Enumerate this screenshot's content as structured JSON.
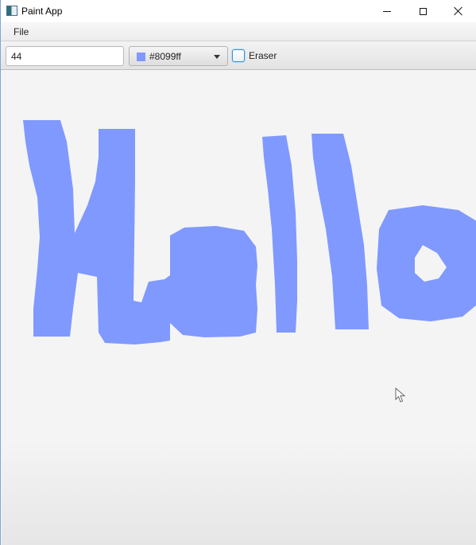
{
  "window": {
    "title": "Paint App",
    "icon": "app-icon",
    "controls": [
      "minimize-icon",
      "maximize-icon",
      "close-icon"
    ]
  },
  "menubar": {
    "items": [
      {
        "label": "File"
      }
    ]
  },
  "toolbar": {
    "brush_size_value": "44",
    "color_picker": {
      "value": "#8099ff",
      "swatch_color": "#8099ff",
      "arrow_icon": "chevron-down-icon"
    },
    "eraser": {
      "label": "Eraser",
      "checked": false
    }
  },
  "canvas": {
    "stroke_color": "#8099ff",
    "cursor_icon": "mouse-pointer-icon"
  }
}
